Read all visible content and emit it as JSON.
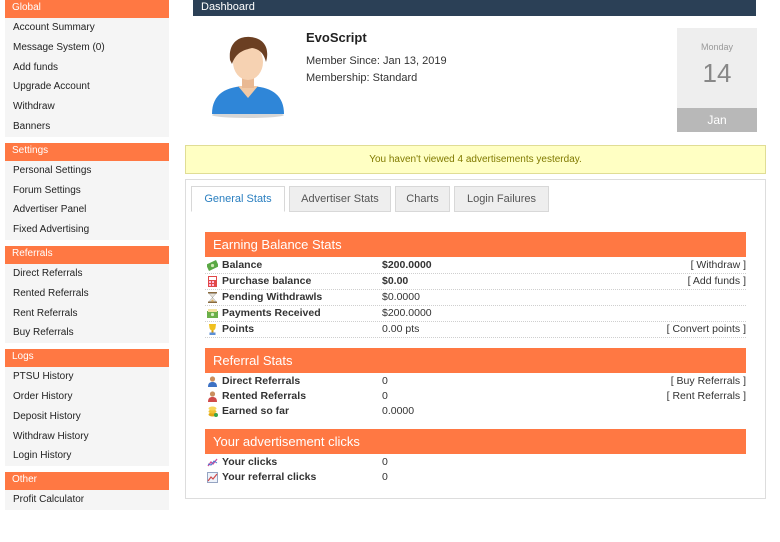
{
  "sidebar": {
    "groups": [
      {
        "title": "Global",
        "items": [
          "Account Summary",
          "Message System (0)",
          "Add funds",
          "Upgrade Account",
          "Withdraw",
          "Banners"
        ]
      },
      {
        "title": "Settings",
        "items": [
          "Personal Settings",
          "Forum Settings",
          "Advertiser Panel",
          "Fixed Advertising"
        ]
      },
      {
        "title": "Referrals",
        "items": [
          "Direct Referrals",
          "Rented Referrals",
          "Rent Referrals",
          "Buy Referrals"
        ]
      },
      {
        "title": "Logs",
        "items": [
          "PTSU History",
          "Order History",
          "Deposit History",
          "Withdraw History",
          "Login History"
        ]
      },
      {
        "title": "Other",
        "items": [
          "Profit Calculator"
        ]
      }
    ]
  },
  "dashboard": {
    "title": "Dashboard",
    "username": "EvoScript",
    "member_since": "Member Since: Jan 13, 2019",
    "membership": "Membership: Standard",
    "calendar": {
      "weekday": "Monday",
      "day": "14",
      "month": "Jan"
    },
    "notice": "You haven't viewed 4 advertisements yesterday."
  },
  "tabs": [
    "General Stats",
    "Advertiser Stats",
    "Charts",
    "Login Failures"
  ],
  "earning": {
    "title": "Earning Balance Stats",
    "rows": [
      {
        "label": "Balance",
        "value": "$200.0000",
        "action": "[ Withdraw ]",
        "icon": "money-icon"
      },
      {
        "label": "Purchase balance",
        "value": "$0.00",
        "action": "[ Add funds ]",
        "icon": "calculator-icon"
      },
      {
        "label": "Pending Withdrawls",
        "value": "$0.0000",
        "action": "",
        "icon": "hourglass-icon"
      },
      {
        "label": "Payments Received",
        "value": "$200.0000",
        "action": "",
        "icon": "money-received-icon"
      },
      {
        "label": "Points",
        "value": "0.00 pts",
        "action": "[ Convert points ]",
        "icon": "trophy-icon"
      }
    ]
  },
  "referral": {
    "title": "Referral Stats",
    "rows": [
      {
        "label": "Direct Referrals",
        "value": "0",
        "action": "[ Buy Referrals ]",
        "icon": "user-blue-icon"
      },
      {
        "label": "Rented Referrals",
        "value": "0",
        "action": "[ Rent Referrals ]",
        "icon": "user-red-icon"
      },
      {
        "label": "Earned so far",
        "value": "0.0000",
        "action": "",
        "icon": "coins-icon"
      }
    ]
  },
  "clicks": {
    "title": "Your advertisement clicks",
    "rows": [
      {
        "label": "Your clicks",
        "value": "0",
        "icon": "chart-line-icon"
      },
      {
        "label": "Your referral clicks",
        "value": "0",
        "icon": "chart-image-icon"
      }
    ]
  },
  "colors": {
    "accent": "#ff7843",
    "header": "#2b4056",
    "notice_bg": "#ffffc3",
    "tab_active": "#2a7fc0"
  }
}
